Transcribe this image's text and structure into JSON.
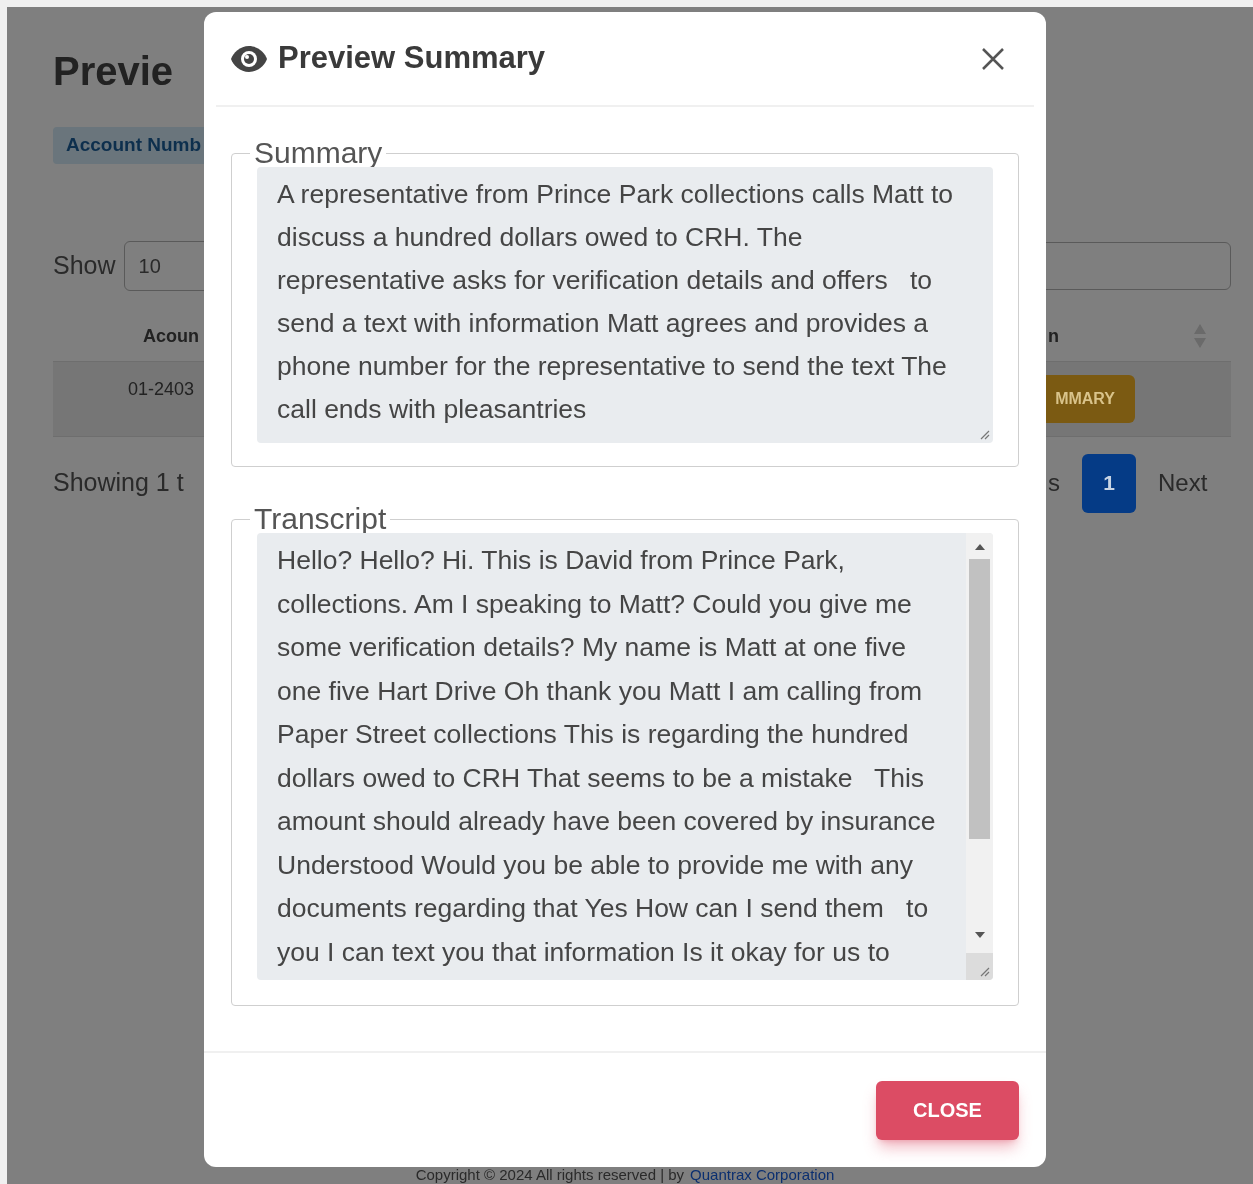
{
  "page": {
    "title": "Previe",
    "badge": "Account Numb",
    "show_label": "Show",
    "page_size": "10",
    "table": {
      "columns": [
        "Acoun",
        "n"
      ],
      "rows": [
        {
          "cells": [
            "01-2403"
          ],
          "action": "MMARY"
        }
      ]
    },
    "info": "Showing 1 t",
    "pagination": {
      "previous": "s",
      "pages": [
        {
          "label": "1",
          "selected": true
        }
      ],
      "next": "Next"
    },
    "footer": {
      "text": "Copyright © 2024 All rights reserved | by",
      "link": "Quantrax Corporation"
    }
  },
  "modal": {
    "title": "Preview Summary",
    "sections": [
      {
        "legend": "Summary",
        "scrollable": false,
        "text": "A representative from Prince Park collections calls Matt to discuss a hundred dollars owed to CRH. The representative asks for verification details and offers   to send a text with information Matt agrees and provides a phone number for the representative to send the text The call ends with pleasantries"
      },
      {
        "legend": "Transcript",
        "scrollable": true,
        "text": "Hello? Hello? Hi. This is David from Prince Park, collections. Am I speaking to Matt? Could you give me some verification details? My name is Matt at one five one five Hart Drive Oh thank you Matt I am calling from Paper Street collections This is regarding the hundred dollars owed to CRH That seems to be a mistake   This amount should already have been covered by insurance Understood Would you be able to provide me with any documents regarding that Yes How can I send them   to you I can text you that information Is it okay for us to"
      }
    ],
    "close_button": "CLOSE"
  }
}
